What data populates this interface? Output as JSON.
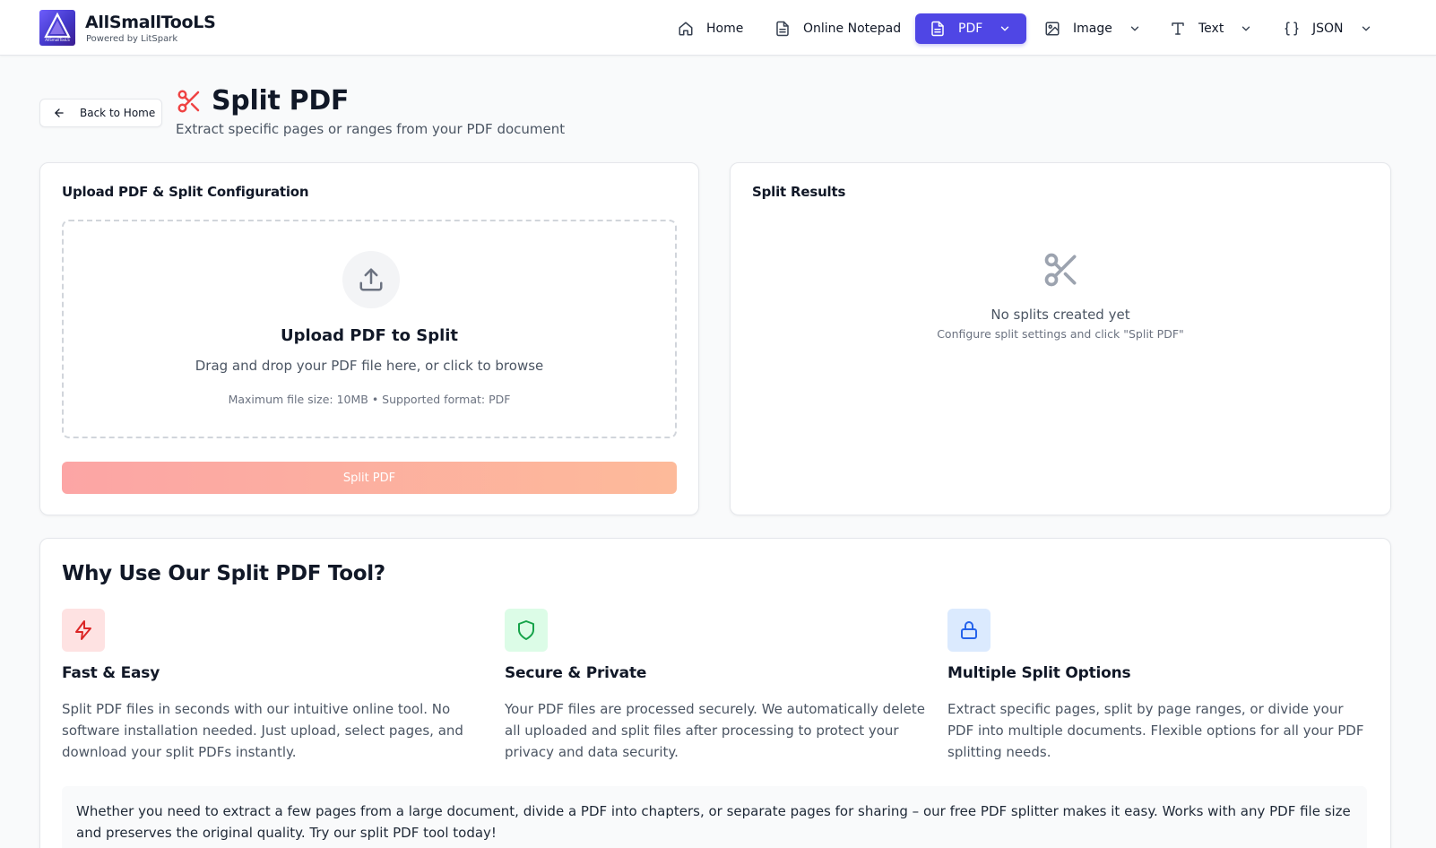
{
  "brand": {
    "name": "AllSmallTooLS",
    "tagline": "Powered by LitSpark",
    "logo_text": "AllSmallTooLS"
  },
  "nav": {
    "home": "Home",
    "notepad": "Online Notepad",
    "pdf": "PDF",
    "image": "Image",
    "text": "Text",
    "json": "JSON",
    "active": "PDF",
    "accent_color": "#4f46e5"
  },
  "page": {
    "back_label": "Back to Home",
    "title": "Split PDF",
    "subtitle": "Extract specific pages or ranges from your PDF document"
  },
  "upload_card": {
    "title": "Upload PDF & Split Configuration",
    "upload_title": "Upload PDF to Split",
    "upload_desc": "Drag and drop your PDF file here, or click to browse",
    "upload_meta": "Maximum file size: 10MB • Supported format: PDF",
    "split_button": "Split PDF"
  },
  "results_card": {
    "title": "Split Results",
    "empty_title": "No splits created yet",
    "empty_sub": "Configure split settings and click \"Split PDF\""
  },
  "why": {
    "title": "Why Use Our Split PDF Tool?",
    "features": [
      {
        "icon": "lightning-icon",
        "title": "Fast & Easy",
        "desc": "Split PDF files in seconds with our intuitive online tool. No software installation needed. Just upload, select pages, and download your split PDFs instantly."
      },
      {
        "icon": "shield-icon",
        "title": "Secure & Private",
        "desc": "Your PDF files are processed securely. We automatically delete all uploaded and split files after processing to protect your privacy and data security."
      },
      {
        "icon": "lock-icon",
        "title": "Multiple Split Options",
        "desc": "Extract specific pages, split by page ranges, or divide your PDF into multiple documents. Flexible options for all your PDF splitting needs."
      }
    ],
    "note": "Whether you need to extract a few pages from a large document, divide a PDF into chapters, or separate pages for sharing – our free PDF splitter makes it easy. Works with any PDF file size and preserves the original quality. Try our split PDF tool today!"
  }
}
